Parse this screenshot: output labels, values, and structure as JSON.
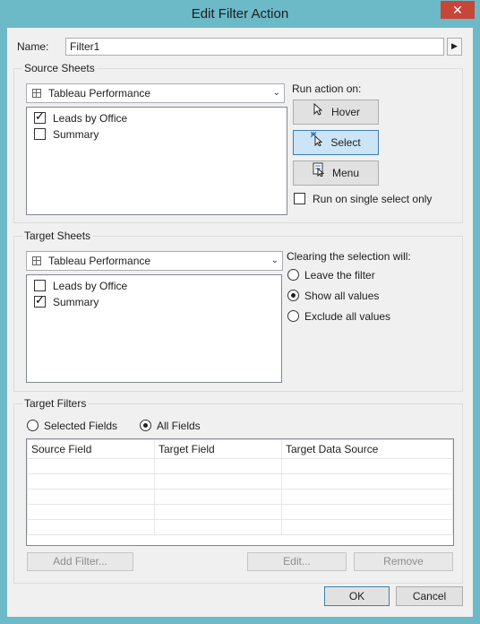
{
  "window": {
    "title": "Edit Filter Action",
    "close_glyph": "✕"
  },
  "name": {
    "label": "Name:",
    "value": "Filter1",
    "arrow_glyph": "▶"
  },
  "source": {
    "group_title": "Source Sheets",
    "dropdown_value": "Tableau Performance",
    "sheets": [
      {
        "label": "Leads by Office",
        "checked": true
      },
      {
        "label": "Summary",
        "checked": false
      }
    ],
    "run_action_label": "Run action on:",
    "hover_label": "Hover",
    "select_label": "Select",
    "menu_label": "Menu",
    "selected_action": "Select",
    "single_select_label": "Run on single select only",
    "single_select_checked": false
  },
  "target": {
    "group_title": "Target Sheets",
    "dropdown_value": "Tableau Performance",
    "sheets": [
      {
        "label": "Leads by Office",
        "checked": false
      },
      {
        "label": "Summary",
        "checked": true
      }
    ],
    "clearing_label": "Clearing the selection will:",
    "options": [
      {
        "label": "Leave the filter",
        "selected": false
      },
      {
        "label": "Show all values",
        "selected": true
      },
      {
        "label": "Exclude all values",
        "selected": false
      }
    ]
  },
  "filters": {
    "group_title": "Target Filters",
    "selected_fields_label": "Selected Fields",
    "all_fields_label": "All Fields",
    "mode": "All Fields",
    "columns": [
      "Source Field",
      "Target Field",
      "Target Data Source"
    ],
    "rows": [],
    "add_filter_label": "Add Filter...",
    "edit_label": "Edit...",
    "remove_label": "Remove"
  },
  "footer": {
    "ok_label": "OK",
    "cancel_label": "Cancel"
  },
  "colors": {
    "window_frame": "#6cb9c7",
    "dialog_bg": "#f0f0f0",
    "selected_button": "#cce4f7",
    "close_button": "#c74638"
  },
  "icons": {
    "hover": "pointer-icon",
    "select": "select-burst-icon",
    "menu": "menu-icon",
    "sheet": "grid-sheet-icon"
  }
}
